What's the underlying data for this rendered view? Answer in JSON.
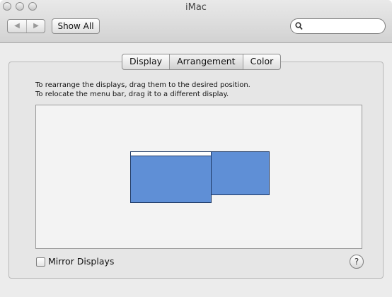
{
  "window": {
    "title": "iMac"
  },
  "toolbar": {
    "back_icon": "◀",
    "forward_icon": "▶",
    "show_all_label": "Show All",
    "search": {
      "value": "",
      "placeholder": ""
    }
  },
  "tabs": [
    {
      "label": "Display",
      "selected": false
    },
    {
      "label": "Arrangement",
      "selected": true
    },
    {
      "label": "Color",
      "selected": false
    }
  ],
  "arrangement": {
    "instruction_line1": "To rearrange the displays, drag them to the desired position.",
    "instruction_line2": "To relocate the menu bar, drag it to a different display.",
    "display_color": "#5f8fd6",
    "displays": [
      {
        "name": "main-display",
        "has_menu_bar": true
      },
      {
        "name": "secondary-display",
        "has_menu_bar": false
      }
    ]
  },
  "options": {
    "mirror_displays_label": "Mirror Displays",
    "mirror_displays_checked": false,
    "help_label": "?"
  }
}
